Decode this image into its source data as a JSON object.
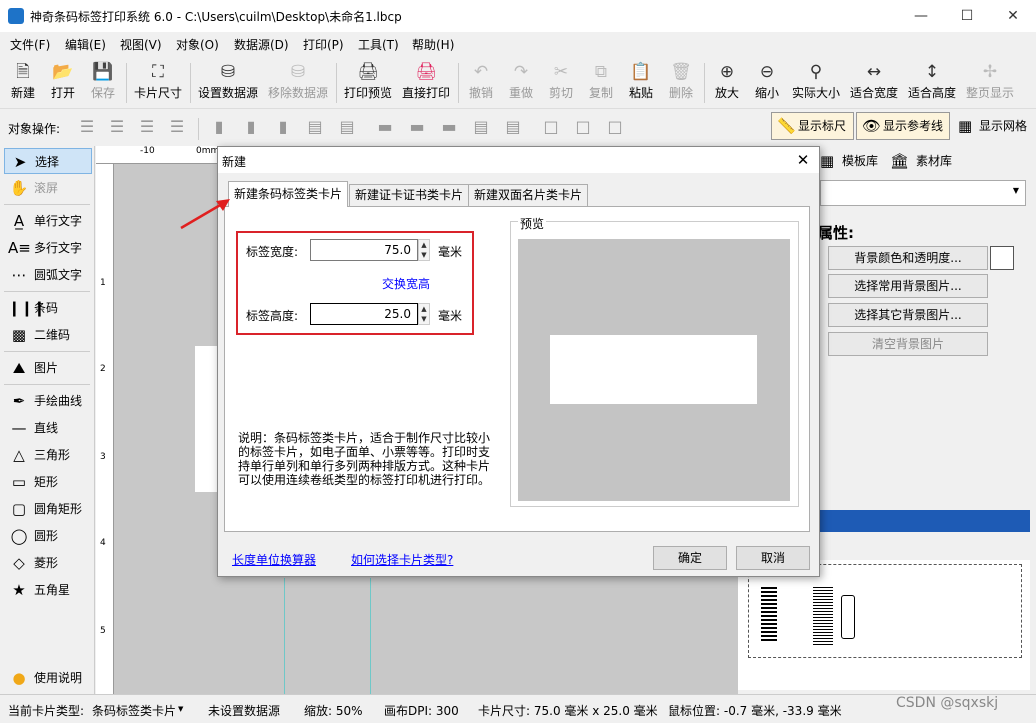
{
  "window": {
    "title": "神奇条码标签打印系统 6.0 - C:\\Users\\cuilm\\Desktop\\未命名1.lbcp"
  },
  "menu": [
    "文件(F)",
    "编辑(E)",
    "视图(V)",
    "对象(O)",
    "数据源(D)",
    "打印(P)",
    "工具(T)",
    "帮助(H)"
  ],
  "toolbar": {
    "new": "新建",
    "open": "打开",
    "save": "保存",
    "card_size": "卡片尺寸",
    "set_datasource": "设置数据源",
    "remove_datasource": "移除数据源",
    "print_preview": "打印预览",
    "direct_print": "直接打印",
    "undo": "撤销",
    "redo": "重做",
    "cut": "剪切",
    "copy": "复制",
    "paste": "粘贴",
    "delete": "删除",
    "zoom_in": "放大",
    "zoom_out": "缩小",
    "actual_size": "实际大小",
    "fit_width": "适合宽度",
    "fit_height": "适合高度",
    "full_page": "整页显示"
  },
  "objbar": {
    "label": "对象操作:",
    "show_ruler": "显示标尺",
    "show_guides": "显示参考线",
    "show_grid": "显示网格"
  },
  "tools": {
    "select": "选择",
    "scroll": "滚屏",
    "single_text": "单行文字",
    "multi_text": "多行文字",
    "arc_text": "圆弧文字",
    "barcode": "条码",
    "qrcode": "二维码",
    "image": "图片",
    "freehand": "手绘曲线",
    "line": "直线",
    "triangle": "三角形",
    "rectangle": "矩形",
    "round_rect": "圆角矩形",
    "circle": "圆形",
    "diamond": "菱形",
    "star": "五角星",
    "help": "使用说明"
  },
  "ruler": {
    "h_ticks": [
      "-10",
      "0mm"
    ],
    "v_ticks": [
      "1",
      "2",
      "3",
      "4",
      "5"
    ]
  },
  "right_panel": {
    "tab_templates": "模板库",
    "tab_assets": "素材库",
    "properties_title": "属性:",
    "bg_color_btn": "背景颜色和透明度...",
    "common_bg_btn": "选择常用背景图片...",
    "other_bg_btn": "选择其它背景图片...",
    "clear_bg_btn": "清空背景图片"
  },
  "status": {
    "card_type_label": "当前卡片类型:",
    "card_type_value": "条码标签类卡片",
    "datasource": "未设置数据源",
    "zoom": "缩放: 50%",
    "dpi": "画布DPI: 300",
    "card_size": "卡片尺寸: 75.0 毫米 x 25.0 毫米",
    "mouse_pos": "鼠标位置: -0.7 毫米, -33.9 毫米"
  },
  "dialog": {
    "title": "新建",
    "tabs": [
      "新建条码标签类卡片",
      "新建证卡证书类卡片",
      "新建双面名片类卡片"
    ],
    "active_tab": 0,
    "width_label": "标签宽度:",
    "width_value": "75.0",
    "width_unit": "毫米",
    "swap_link": "交换宽高",
    "height_label": "标签高度:",
    "height_value": "25.0",
    "height_unit": "毫米",
    "preview_label": "预览",
    "description": "说明：条码标签类卡片，适合于制作尺寸比较小的标签卡片，如电子面单、小票等等。打印时支持单行单列和单行多列两种排版方式。这种卡片可以使用连续卷纸类型的标签打印机进行打印。",
    "unit_converter_link": "长度单位换算器",
    "how_to_choose_link": "如何选择卡片类型?",
    "ok": "确定",
    "cancel": "取消"
  },
  "watermark": "CSDN @sqxskj",
  "colors": {
    "highlight_red": "#d9232a",
    "link_blue": "#0000ff",
    "selection_bar": "#1e5bb5"
  }
}
